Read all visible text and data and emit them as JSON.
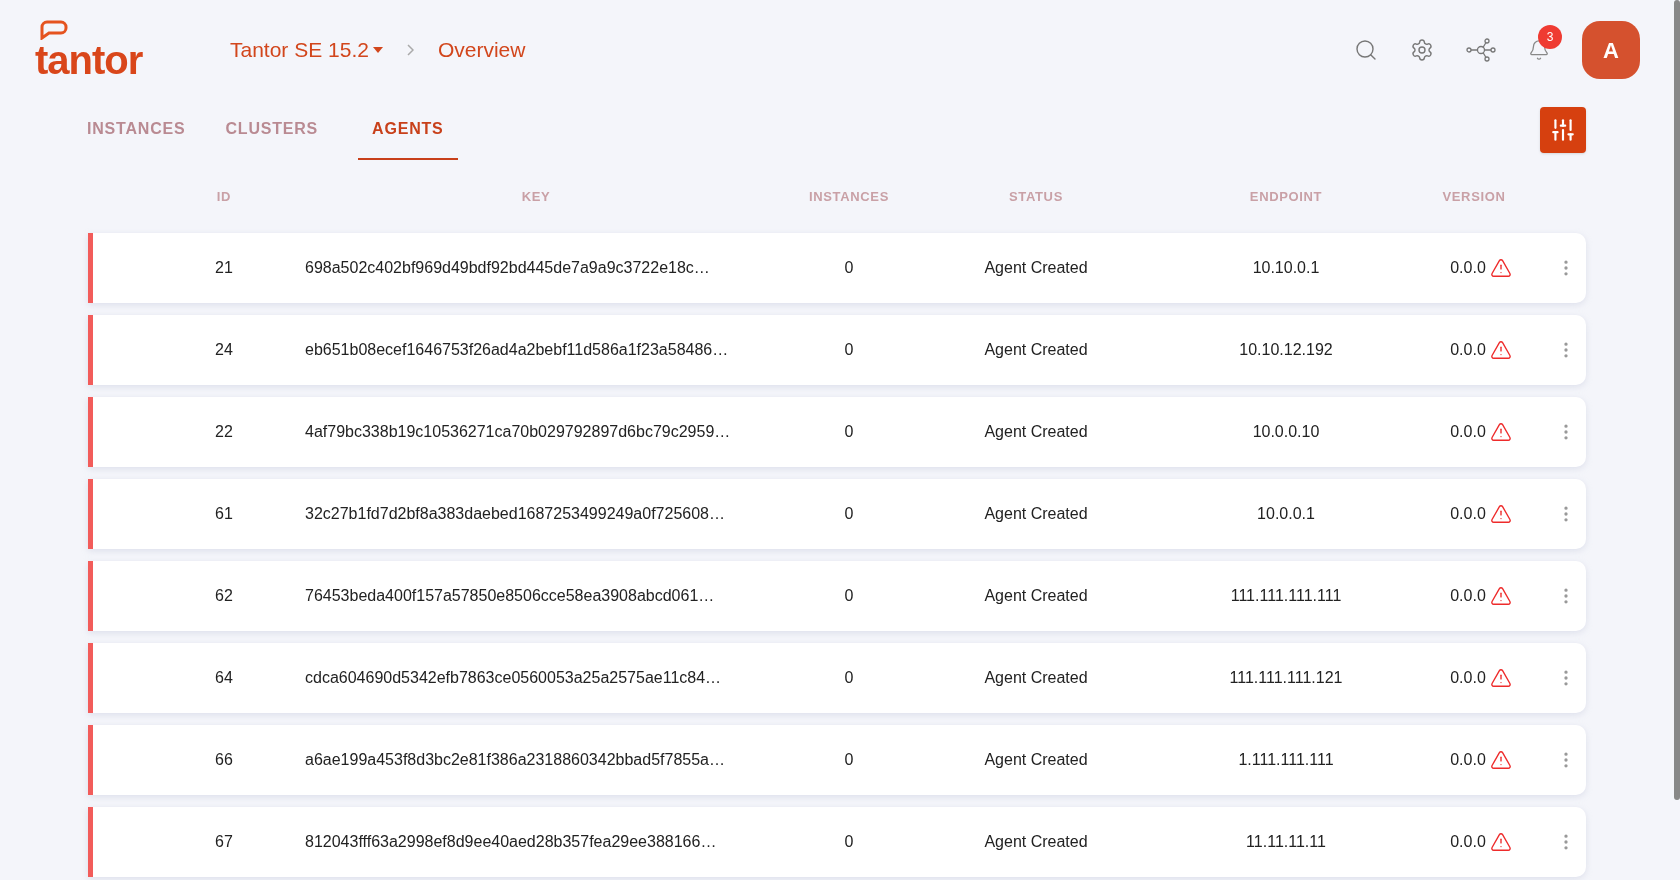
{
  "logo": "tantor",
  "breadcrumb": {
    "product": "Tantor SE 15.2",
    "page": "Overview"
  },
  "notifications": {
    "count": "3"
  },
  "avatar": "A",
  "tabs": [
    {
      "label": "INSTANCES",
      "selected": false
    },
    {
      "label": "CLUSTERS",
      "selected": false
    },
    {
      "label": "AGENTS",
      "selected": true
    }
  ],
  "table": {
    "columns": [
      "ID",
      "KEY",
      "INSTANCES",
      "STATUS",
      "ENDPOINT",
      "VERSION"
    ],
    "rows": [
      {
        "id": "21",
        "key": "698a502c402bf969d49bdf92bd445de7a9a9c3722e18c…",
        "instances": "0",
        "status": "Agent Created",
        "endpoint": "10.10.0.1",
        "version": "0.0.0",
        "warning": true
      },
      {
        "id": "24",
        "key": "eb651b08ecef1646753f26ad4a2bebf11d586a1f23a58486…",
        "instances": "0",
        "status": "Agent Created",
        "endpoint": "10.10.12.192",
        "version": "0.0.0",
        "warning": true
      },
      {
        "id": "22",
        "key": "4af79bc338b19c10536271ca70b029792897d6bc79c2959…",
        "instances": "0",
        "status": "Agent Created",
        "endpoint": "10.0.0.10",
        "version": "0.0.0",
        "warning": true
      },
      {
        "id": "61",
        "key": "32c27b1fd7d2bf8a383daebed1687253499249a0f725608…",
        "instances": "0",
        "status": "Agent Created",
        "endpoint": "10.0.0.1",
        "version": "0.0.0",
        "warning": true
      },
      {
        "id": "62",
        "key": "76453beda400f157a57850e8506cce58ea3908abcd061…",
        "instances": "0",
        "status": "Agent Created",
        "endpoint": "111.111.111.111",
        "version": "0.0.0",
        "warning": true
      },
      {
        "id": "64",
        "key": "cdca604690d5342efb7863ce0560053a25a2575ae11c84…",
        "instances": "0",
        "status": "Agent Created",
        "endpoint": "111.111.111.121",
        "version": "0.0.0",
        "warning": true
      },
      {
        "id": "66",
        "key": "a6ae199a453f8d3bc2e81f386a2318860342bbad5f7855a…",
        "instances": "0",
        "status": "Agent Created",
        "endpoint": "1.111.111.111",
        "version": "0.0.0",
        "warning": true
      },
      {
        "id": "67",
        "key": "812043fff63a2998ef8d9ee40aed28b357fea29ee388166…",
        "instances": "0",
        "status": "Agent Created",
        "endpoint": "11.11.11.11",
        "version": "0.0.0",
        "warning": true
      }
    ]
  }
}
